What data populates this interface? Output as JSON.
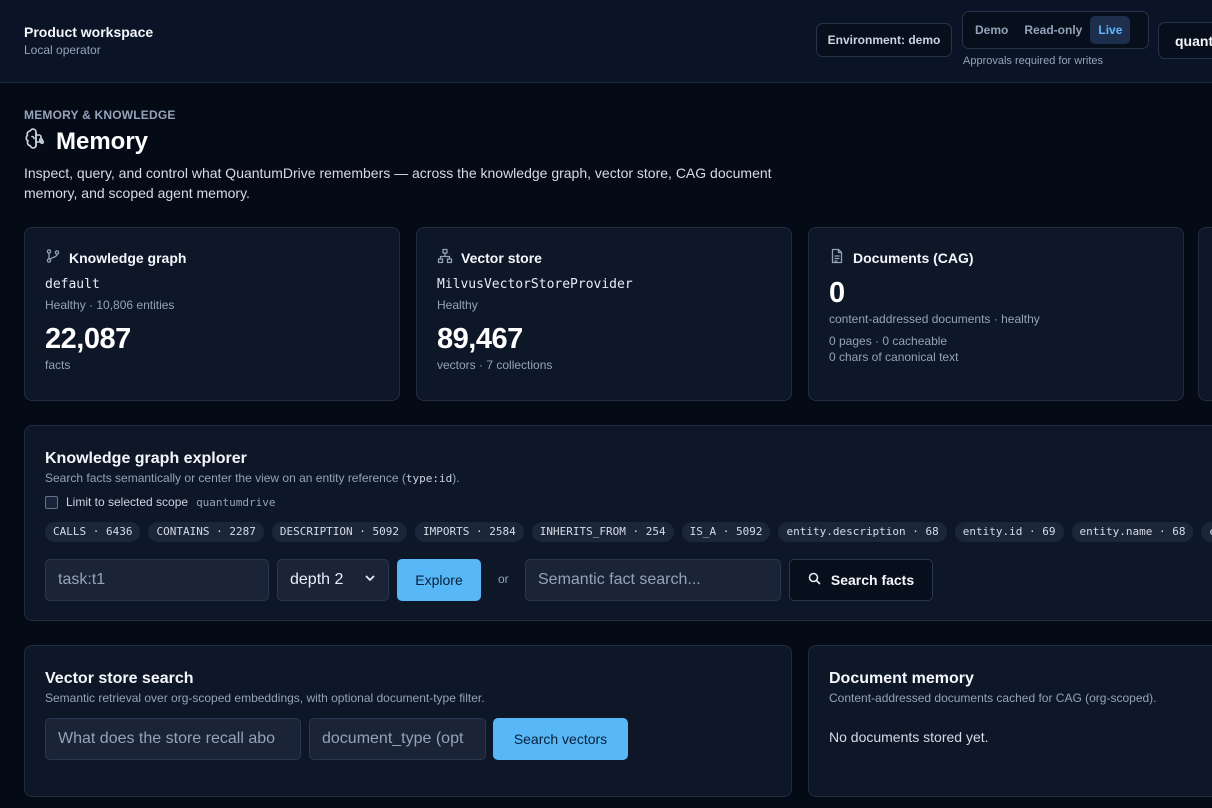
{
  "topbar": {
    "workspace_title": "Product workspace",
    "workspace_sub": "Local operator",
    "environment": "Environment: demo",
    "modes": [
      "Demo",
      "Read-only",
      "Live"
    ],
    "active_mode": "Live",
    "mode_note": "Approvals required for writes",
    "scope": "quantumdrive"
  },
  "header": {
    "kicker": "MEMORY & KNOWLEDGE",
    "title": "Memory",
    "icon": "brain-icon",
    "description": "Inspect, query, and control what QuantumDrive remembers — across the knowledge graph, vector store, CAG document memory, and scoped agent memory."
  },
  "cards": {
    "kg": {
      "title": "Knowledge graph",
      "icon": "git-branch-icon",
      "name": "default",
      "status": "Healthy · 10,806 entities",
      "value": "22,087",
      "unit": "facts"
    },
    "vs": {
      "title": "Vector store",
      "icon": "network-icon",
      "name": "MilvusVectorStoreProvider",
      "status": "Healthy",
      "value": "89,467",
      "unit": "vectors · 7 collections"
    },
    "docs": {
      "title": "Documents (CAG)",
      "icon": "document-icon",
      "value": "0",
      "line1": "content-addressed documents · healthy",
      "line2": "0 pages · 0 cacheable",
      "line3": "0 chars of canonical text"
    }
  },
  "explorer": {
    "title": "Knowledge graph explorer",
    "sub_before": "Search facts semantically or center the view on an entity reference (",
    "sub_code": "type:id",
    "sub_after": ").",
    "scope_label": "Limit to selected scope",
    "scope_value": "quantumdrive",
    "chips": [
      "CALLS · 6436",
      "CONTAINS · 2287",
      "DESCRIPTION · 5092",
      "IMPORTS · 2584",
      "INHERITS_FROM · 254",
      "IS_A · 5092",
      "entity.description · 68",
      "entity.id · 69",
      "entity.name · 68",
      "enti"
    ],
    "entity_input": "task:t1",
    "depth": "depth 2",
    "explore_label": "Explore",
    "or_label": "or",
    "search_placeholder": "Semantic fact search...",
    "search_label": "Search facts"
  },
  "vector_search": {
    "title": "Vector store search",
    "sub": "Semantic retrieval over org-scoped embeddings, with optional document-type filter.",
    "query_placeholder": "What does the store recall abo",
    "type_placeholder": "document_type (opt",
    "search_label": "Search vectors"
  },
  "doc_memory": {
    "title": "Document memory",
    "sub": "Content-addressed documents cached for CAG (org-scoped).",
    "empty": "No documents stored yet."
  },
  "colors": {
    "background": "#050a17",
    "card": "#0e1728",
    "accent": "#58b7f7",
    "active_mode": "#60b6ff"
  }
}
